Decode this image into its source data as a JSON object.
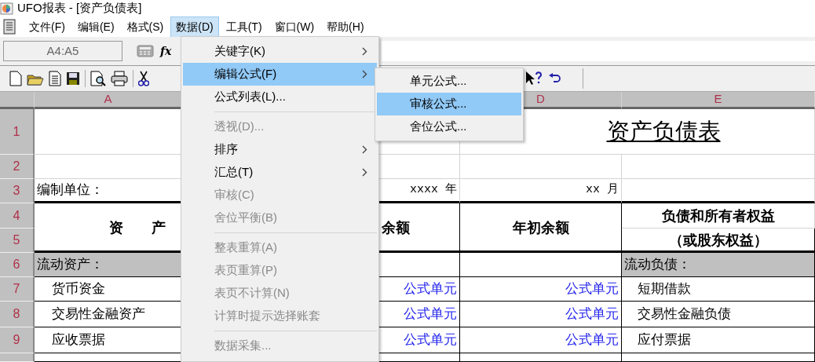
{
  "window": {
    "title": "UFO报表 - [资产负债表]"
  },
  "menubar": [
    {
      "label": "文件(F)",
      "selected": false
    },
    {
      "label": "编辑(E)",
      "selected": false
    },
    {
      "label": "格式(S)",
      "selected": false
    },
    {
      "label": "数据(D)",
      "selected": true
    },
    {
      "label": "工具(T)",
      "selected": false
    },
    {
      "label": "窗口(W)",
      "selected": false
    },
    {
      "label": "帮助(H)",
      "selected": false
    }
  ],
  "formula_bar": {
    "name_box": "A4:A5",
    "fx_label": "fx"
  },
  "sheet": {
    "columns": {
      "a": "A",
      "d": "D",
      "e": "E"
    },
    "rows": [
      {
        "number": "1",
        "kind": "title",
        "title": "资产负债表"
      },
      {
        "number": "2",
        "kind": "blank"
      },
      {
        "number": "3",
        "kind": "info",
        "a": "编制单位：",
        "c": "xxxx 年",
        "d": "xx 月"
      },
      {
        "kind": "header",
        "numbers": [
          "4",
          "5"
        ],
        "a": "资　　产",
        "c": "余额",
        "d": "年初余额",
        "e": [
          "负债和所有者权益",
          "（或股东权益）"
        ]
      },
      {
        "number": "6",
        "kind": "section",
        "a": "流动资产：",
        "e": "流动负债："
      },
      {
        "number": "7",
        "kind": "item",
        "a": "货币资金",
        "c": "公式单元",
        "d": "公式单元",
        "e": "短期借款"
      },
      {
        "number": "8",
        "kind": "item",
        "a": "交易性金融资产",
        "c": "公式单元",
        "d": "公式单元",
        "e": "交易性金融负债"
      },
      {
        "number": "9",
        "kind": "item",
        "a": "应收票据",
        "c": "公式单元",
        "d": "公式单元",
        "e": "应付票据"
      }
    ]
  },
  "data_menu": [
    {
      "kind": "item",
      "label": "关键字(K)",
      "disabled": false,
      "submenu": true,
      "selected": false
    },
    {
      "kind": "item",
      "label": "编辑公式(F)",
      "disabled": false,
      "submenu": true,
      "selected": true
    },
    {
      "kind": "item",
      "label": "公式列表(L)...",
      "disabled": false,
      "submenu": false,
      "selected": false
    },
    {
      "kind": "separator"
    },
    {
      "kind": "item",
      "label": "透视(D)...",
      "disabled": true,
      "submenu": false,
      "selected": false
    },
    {
      "kind": "item",
      "label": "排序",
      "disabled": false,
      "submenu": true,
      "selected": false
    },
    {
      "kind": "item",
      "label": "汇总(T)",
      "disabled": false,
      "submenu": true,
      "selected": false
    },
    {
      "kind": "item",
      "label": "审核(C)",
      "disabled": true,
      "submenu": false,
      "selected": false
    },
    {
      "kind": "item",
      "label": "舍位平衡(B)",
      "disabled": true,
      "submenu": false,
      "selected": false
    },
    {
      "kind": "separator"
    },
    {
      "kind": "item",
      "label": "整表重算(A)",
      "disabled": true,
      "submenu": false,
      "selected": false
    },
    {
      "kind": "item",
      "label": "表页重算(P)",
      "disabled": true,
      "submenu": false,
      "selected": false
    },
    {
      "kind": "item",
      "label": "表页不计算(N)",
      "disabled": true,
      "submenu": false,
      "selected": false
    },
    {
      "kind": "item",
      "label": "计算时提示选择账套",
      "disabled": true,
      "submenu": false,
      "selected": false
    },
    {
      "kind": "separator"
    },
    {
      "kind": "item",
      "label": "数据采集...",
      "disabled": true,
      "submenu": false,
      "selected": false
    }
  ],
  "formula_submenu": [
    {
      "label": "单元公式...",
      "selected": false
    },
    {
      "label": "审核公式...",
      "selected": true
    },
    {
      "label": "舍位公式...",
      "selected": false
    }
  ]
}
